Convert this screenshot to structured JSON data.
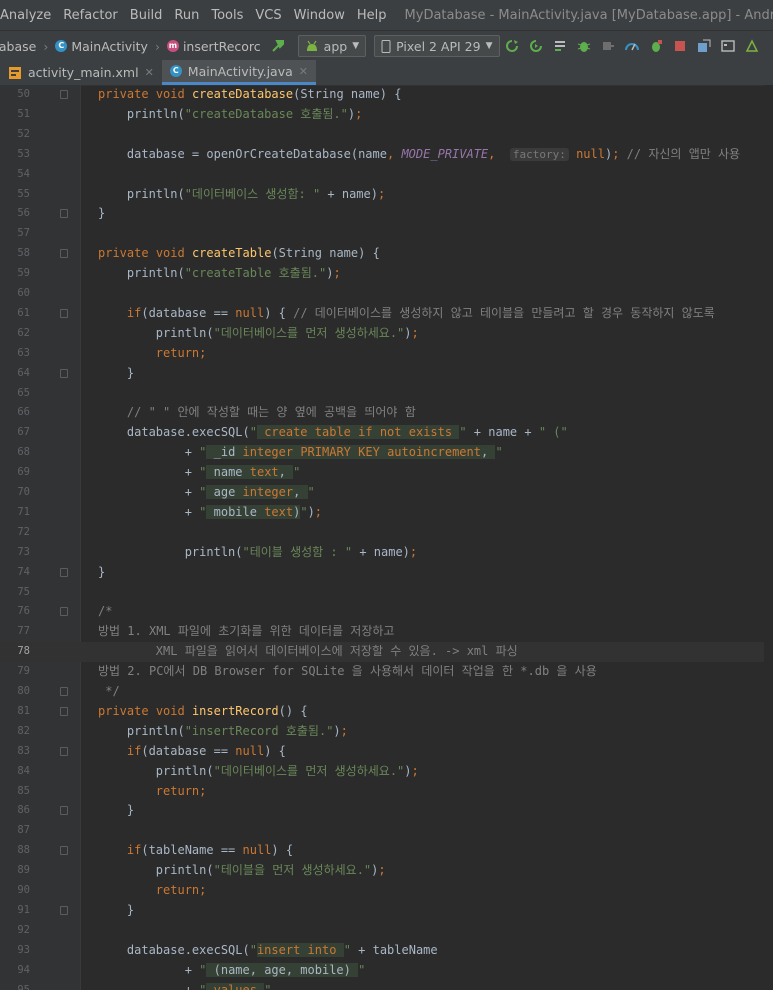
{
  "menu": {
    "items": [
      "Analyze",
      "Refactor",
      "Build",
      "Run",
      "Tools",
      "VCS",
      "Window",
      "Help"
    ],
    "title": "MyDatabase - MainActivity.java [MyDatabase.app] - Android Studio"
  },
  "toolbar": {
    "crumbs": [
      "tabase",
      "MainActivity",
      "insertRecorc"
    ],
    "run_config": "app",
    "device": "Pixel 2 API 29"
  },
  "tabs": [
    {
      "label": "activity_main.xml",
      "active": false
    },
    {
      "label": "MainActivity.java",
      "active": true
    }
  ],
  "current_line": 78,
  "code_lines": [
    {
      "n": 50,
      "t": "private void createDatabase(String name) {"
    },
    {
      "n": 51,
      "t": "    println(\"createDatabase 호출됨.\");"
    },
    {
      "n": 52,
      "t": ""
    },
    {
      "n": 53,
      "t": "    database = openOrCreateDatabase(name, MODE_PRIVATE,  factory: null); // 자신의 앱만 사용"
    },
    {
      "n": 54,
      "t": ""
    },
    {
      "n": 55,
      "t": "    println(\"데이터베이스 생성함: \" + name);"
    },
    {
      "n": 56,
      "t": "}"
    },
    {
      "n": 57,
      "t": ""
    },
    {
      "n": 58,
      "t": "private void createTable(String name) {"
    },
    {
      "n": 59,
      "t": "    println(\"createTable 호출됨.\");"
    },
    {
      "n": 60,
      "t": ""
    },
    {
      "n": 61,
      "t": "    if(database == null) { // 데이터베이스를 생성하지 않고 테이블을 만들려고 할 경우 동작하지 않도록"
    },
    {
      "n": 62,
      "t": "        println(\"데이터베이스를 먼저 생성하세요.\");"
    },
    {
      "n": 63,
      "t": "        return;"
    },
    {
      "n": 64,
      "t": "    }"
    },
    {
      "n": 65,
      "t": ""
    },
    {
      "n": 66,
      "t": "    // \" \" 안에 작성할 때는 양 옆에 공백을 띄어야 함"
    },
    {
      "n": 67,
      "t": "    database.execSQL(\" create table if not exists \" + name + \" (\""
    },
    {
      "n": 68,
      "t": "            + \" _id integer PRIMARY KEY autoincrement, \""
    },
    {
      "n": 69,
      "t": "            + \" name text, \""
    },
    {
      "n": 70,
      "t": "            + \" age integer, \""
    },
    {
      "n": 71,
      "t": "            + \" mobile text)\");"
    },
    {
      "n": 72,
      "t": ""
    },
    {
      "n": 73,
      "t": "            println(\"테이블 생성함 : \" + name);"
    },
    {
      "n": 74,
      "t": "}"
    },
    {
      "n": 75,
      "t": ""
    },
    {
      "n": 76,
      "t": "/*"
    },
    {
      "n": 77,
      "t": "방법 1. XML 파일에 초기화를 위한 데이터를 저장하고"
    },
    {
      "n": 78,
      "t": "        XML 파일을 읽어서 데이터베이스에 저장할 수 있음. -> xml 파싱"
    },
    {
      "n": 79,
      "t": "방법 2. PC에서 DB Browser for SQLite 을 사용해서 데이터 작업을 한 *.db 을 사용"
    },
    {
      "n": 80,
      "t": " */"
    },
    {
      "n": 81,
      "t": "private void insertRecord() {"
    },
    {
      "n": 82,
      "t": "    println(\"insertRecord 호출됨.\");"
    },
    {
      "n": 83,
      "t": "    if(database == null) {"
    },
    {
      "n": 84,
      "t": "        println(\"데이터베이스를 먼저 생성하세요.\");"
    },
    {
      "n": 85,
      "t": "        return;"
    },
    {
      "n": 86,
      "t": "    }"
    },
    {
      "n": 87,
      "t": ""
    },
    {
      "n": 88,
      "t": "    if(tableName == null) {"
    },
    {
      "n": 89,
      "t": "        println(\"테이블을 먼저 생성하세요.\");"
    },
    {
      "n": 90,
      "t": "        return;"
    },
    {
      "n": 91,
      "t": "    }"
    },
    {
      "n": 92,
      "t": ""
    },
    {
      "n": 93,
      "t": "    database.execSQL(\"insert into \" + tableName"
    },
    {
      "n": 94,
      "t": "            + \" (name, age, mobile) \""
    },
    {
      "n": 95,
      "t": "            + \" values \""
    }
  ]
}
